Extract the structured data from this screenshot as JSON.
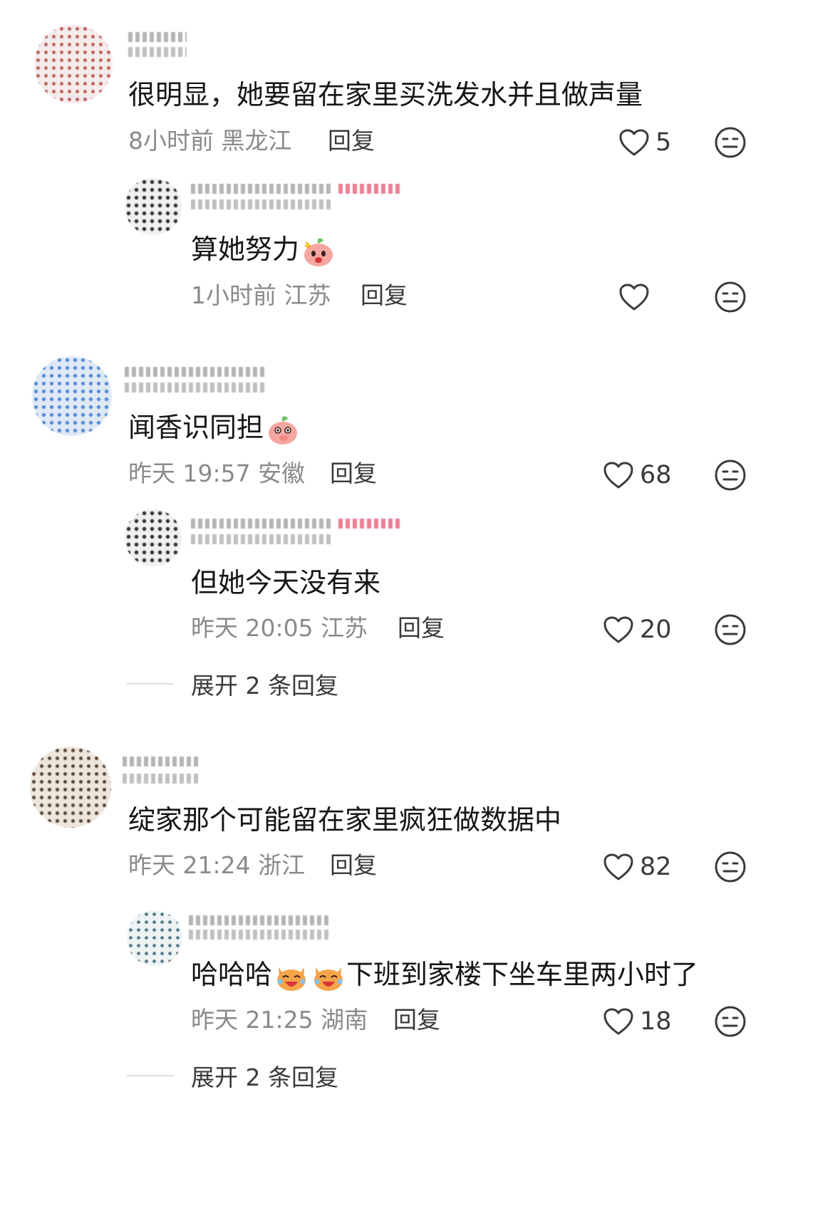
{
  "comments": [
    {
      "text": "很明显，她要留在家里买洗发水并且做声量",
      "time": "8小时前",
      "location": "黑龙江",
      "reply_label": "回复",
      "likes": "5"
    },
    {
      "text": "算她努力",
      "time": "1小时前",
      "location": "江苏",
      "reply_label": "回复",
      "likes": ""
    },
    {
      "text": "闻香识同担",
      "time": "昨天 19:57",
      "location": "安徽",
      "reply_label": "回复",
      "likes": "68"
    },
    {
      "text": "但她今天没有来",
      "time": "昨天 20:05",
      "location": "江苏",
      "reply_label": "回复",
      "likes": "20"
    },
    {
      "text": "绽家那个可能留在家里疯狂做数据中",
      "time": "昨天 21:24",
      "location": "浙江",
      "reply_label": "回复",
      "likes": "82"
    },
    {
      "text_prefix": "哈哈哈",
      "text": "下班到家楼下坐车里两小时了",
      "time": "昨天 21:25",
      "location": "湖南",
      "reply_label": "回复",
      "likes": "18"
    }
  ],
  "expand_labels": [
    "展开 2 条回复",
    "展开 2 条回复"
  ],
  "icons": {
    "like": "heart-outline-icon",
    "dislike": "dislike-face-icon",
    "emoji_peach_angry": "peach-angry-emoji",
    "emoji_peach_shy": "peach-shy-emoji",
    "emoji_cat_laugh": "cat-laugh-emoji"
  },
  "colors": {
    "text": "#161616",
    "meta": "#8a8a8a",
    "action": "#3a3a3a"
  }
}
